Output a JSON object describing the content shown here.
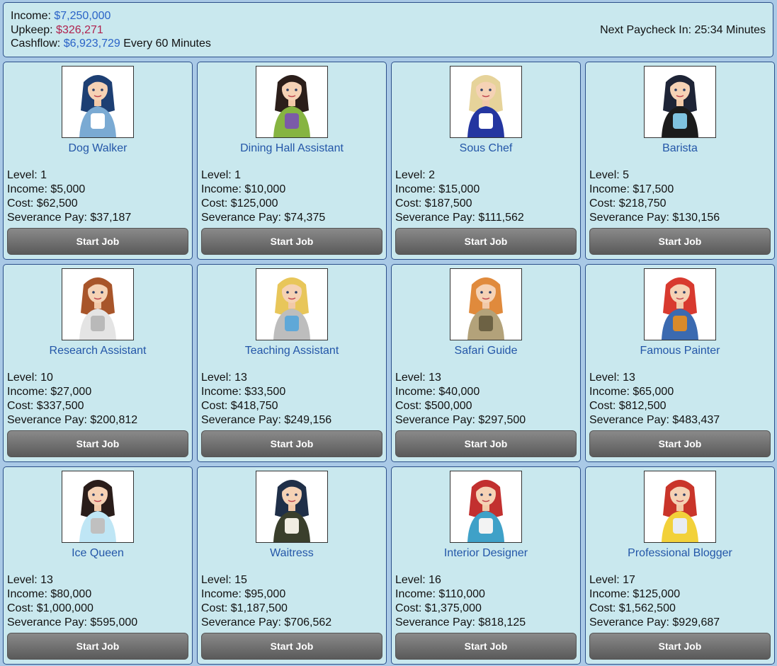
{
  "summary": {
    "income_label": "Income:",
    "income_value": "$7,250,000",
    "upkeep_label": "Upkeep:",
    "upkeep_value": "$326,271",
    "cashflow_label": "Cashflow:",
    "cashflow_value": "$6,923,729",
    "cashflow_suffix": "Every 60 Minutes",
    "next_paycheck": "Next Paycheck In: 25:34 Minutes"
  },
  "labels": {
    "level": "Level:",
    "income": "Income:",
    "cost": "Cost:",
    "severance": "Severance Pay:"
  },
  "jobs": [
    {
      "title": "Dog Walker",
      "level": "1",
      "income": "$5,000",
      "cost": "$62,500",
      "severance": "$37,187",
      "button": "Start Job",
      "hair": "#1d3f73",
      "top": "#7aaad3",
      "accent": "#ffffff"
    },
    {
      "title": "Dining Hall Assistant",
      "level": "1",
      "income": "$10,000",
      "cost": "$125,000",
      "severance": "$74,375",
      "button": "Start Job",
      "hair": "#2b1e1a",
      "top": "#86b441",
      "accent": "#7b5aa8"
    },
    {
      "title": "Sous Chef",
      "level": "2",
      "income": "$15,000",
      "cost": "$187,500",
      "severance": "$111,562",
      "button": "Start Job",
      "hair": "#e6d39a",
      "top": "#2436a0",
      "accent": "#ffffff"
    },
    {
      "title": "Barista",
      "level": "5",
      "income": "$17,500",
      "cost": "$218,750",
      "severance": "$130,156",
      "button": "Start Job",
      "hair": "#1e2436",
      "top": "#1b1b1b",
      "accent": "#7fc3df"
    },
    {
      "title": "Research Assistant",
      "level": "10",
      "income": "$27,000",
      "cost": "$337,500",
      "severance": "$200,812",
      "button": "Start Job",
      "hair": "#a8552a",
      "top": "#e4e4e4",
      "accent": "#b9b9b9"
    },
    {
      "title": "Teaching Assistant",
      "level": "13",
      "income": "$33,500",
      "cost": "$418,750",
      "severance": "$249,156",
      "button": "Start Job",
      "hair": "#e8c65a",
      "top": "#bdbdbd",
      "accent": "#5fa8d8"
    },
    {
      "title": "Safari Guide",
      "level": "13",
      "income": "$40,000",
      "cost": "$500,000",
      "severance": "$297,500",
      "button": "Start Job",
      "hair": "#e08a3c",
      "top": "#b3a27a",
      "accent": "#6d6244"
    },
    {
      "title": "Famous Painter",
      "level": "13",
      "income": "$65,000",
      "cost": "$812,500",
      "severance": "$483,437",
      "button": "Start Job",
      "hair": "#d83a2f",
      "top": "#3b6ab0",
      "accent": "#d98a2a"
    },
    {
      "title": "Ice Queen",
      "level": "13",
      "income": "$80,000",
      "cost": "$1,000,000",
      "severance": "$595,000",
      "button": "Start Job",
      "hair": "#2a1d1a",
      "top": "#bfe6f5",
      "accent": "#c0c0c0"
    },
    {
      "title": "Waitress",
      "level": "15",
      "income": "$95,000",
      "cost": "$1,187,500",
      "severance": "$706,562",
      "button": "Start Job",
      "hair": "#1f2f48",
      "top": "#3a3f2c",
      "accent": "#f1ede2"
    },
    {
      "title": "Interior Designer",
      "level": "16",
      "income": "$110,000",
      "cost": "$1,375,000",
      "severance": "$818,125",
      "button": "Start Job",
      "hair": "#c2302f",
      "top": "#3fa1c8",
      "accent": "#f3f3f3"
    },
    {
      "title": "Professional Blogger",
      "level": "17",
      "income": "$125,000",
      "cost": "$1,562,500",
      "severance": "$929,687",
      "button": "Start Job",
      "hair": "#c9352a",
      "top": "#f2d13a",
      "accent": "#e8ecf2"
    }
  ]
}
